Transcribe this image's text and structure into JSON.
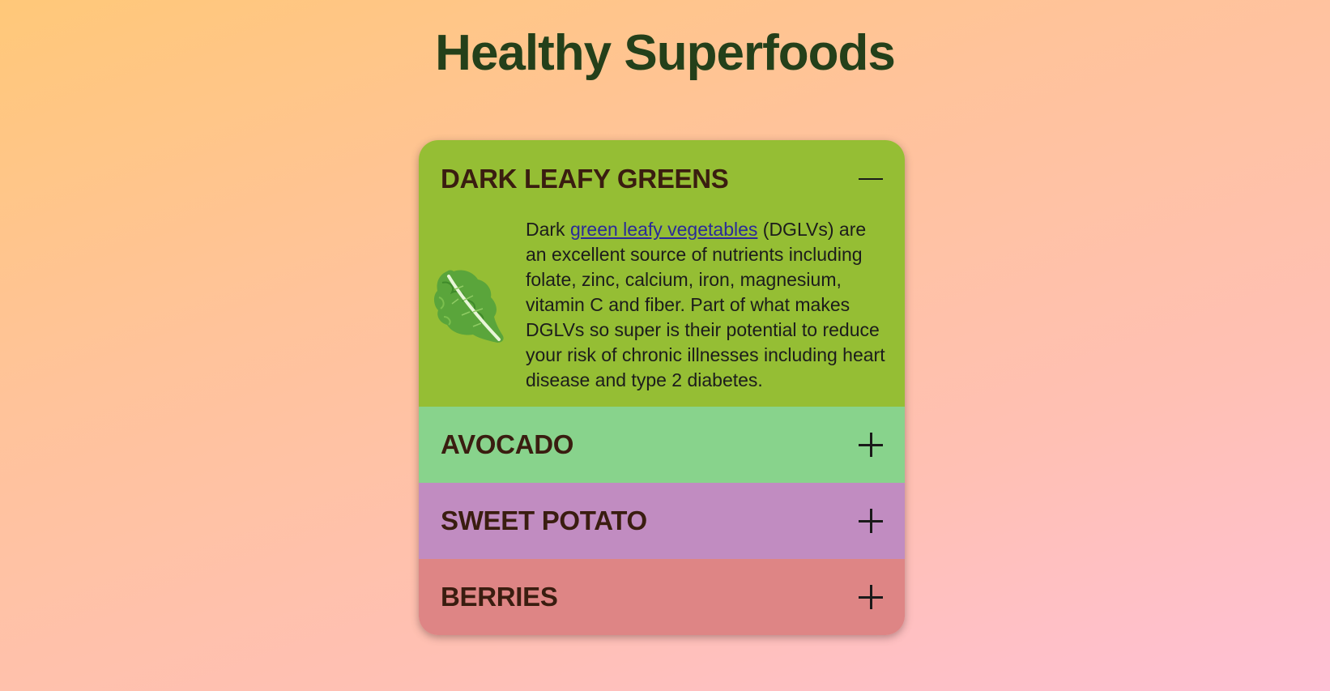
{
  "page": {
    "title": "Healthy Superfoods"
  },
  "accordion": {
    "sections": [
      {
        "title": "DARK LEAFY GREENS",
        "expanded": true,
        "toggle_icon": "minus-icon",
        "color": "#95be34",
        "image_icon": "lettuce-leaf-icon",
        "text_before_link": "Dark ",
        "link_text": "green leafy vegetables",
        "text_after_link": " (DGLVs) are an excellent source of nutrients including folate, zinc, calcium, iron, magnesium, vitamin C and fiber. Part of what makes DGLVs so super is their potential to reduce your risk of chronic illnesses including heart disease and type 2 diabetes."
      },
      {
        "title": "AVOCADO",
        "expanded": false,
        "toggle_icon": "plus-icon",
        "color": "#88d38c"
      },
      {
        "title": "SWEET POTATO",
        "expanded": false,
        "toggle_icon": "plus-icon",
        "color": "#c18cc1"
      },
      {
        "title": "BERRIES",
        "expanded": false,
        "toggle_icon": "plus-icon",
        "color": "#de8585"
      }
    ]
  }
}
